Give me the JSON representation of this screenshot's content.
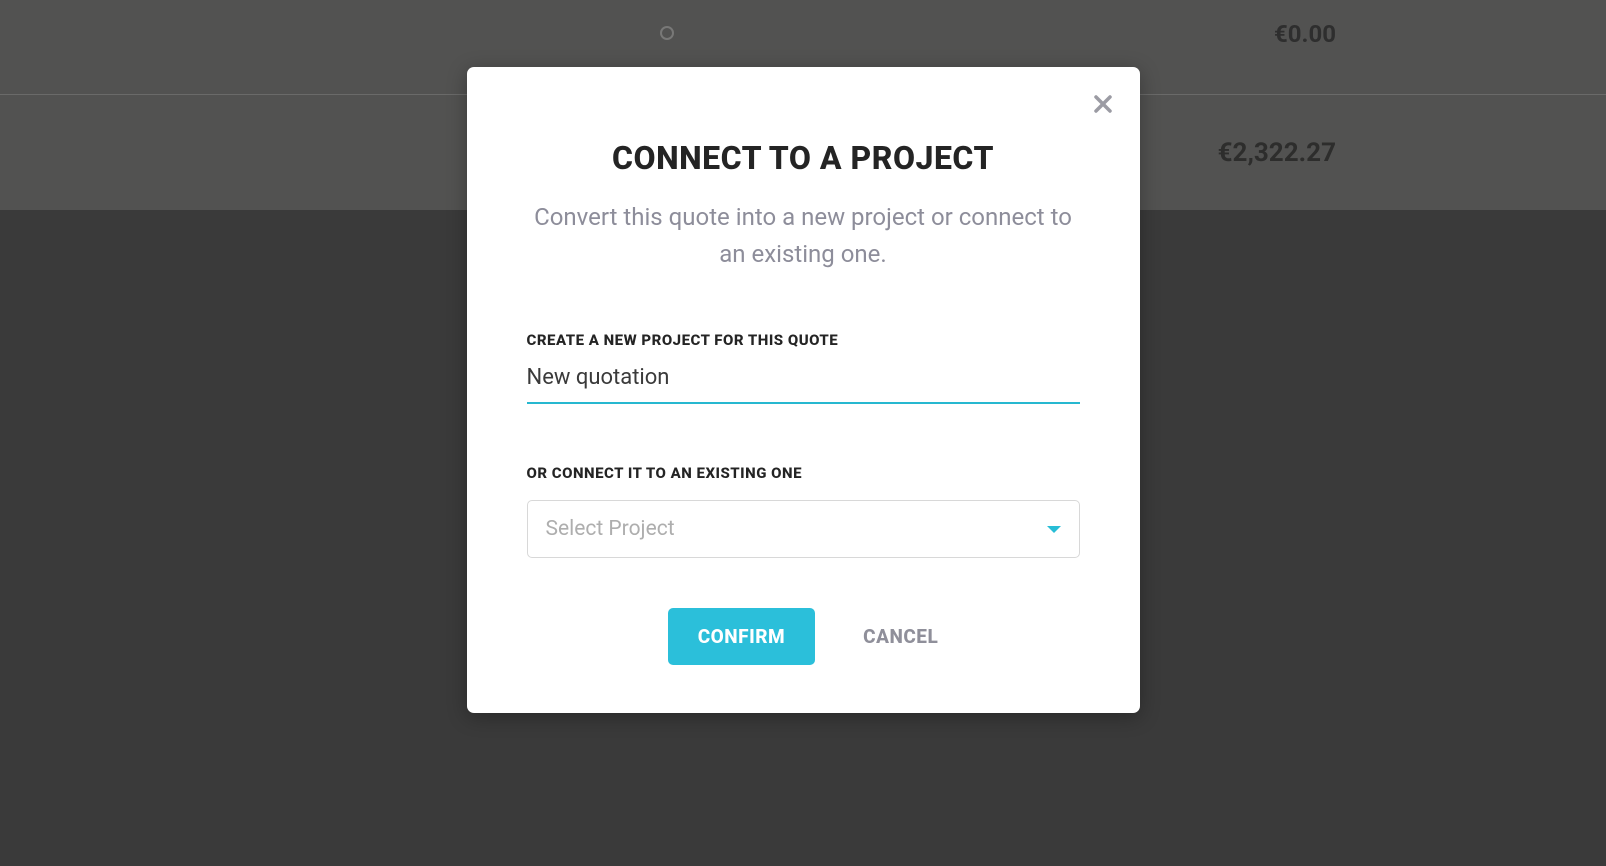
{
  "background": {
    "amount_top": "€0.00",
    "amount_mid": "€2,322.27"
  },
  "modal": {
    "title": "CONNECT TO A PROJECT",
    "subtitle": "Convert this quote into a new project or connect to an existing one.",
    "create_label": "CREATE A NEW PROJECT FOR THIS QUOTE",
    "create_value": "New quotation",
    "connect_label": "OR CONNECT IT TO AN EXISTING ONE",
    "select_placeholder": "Select Project",
    "confirm_label": "CONFIRM",
    "cancel_label": "CANCEL"
  }
}
